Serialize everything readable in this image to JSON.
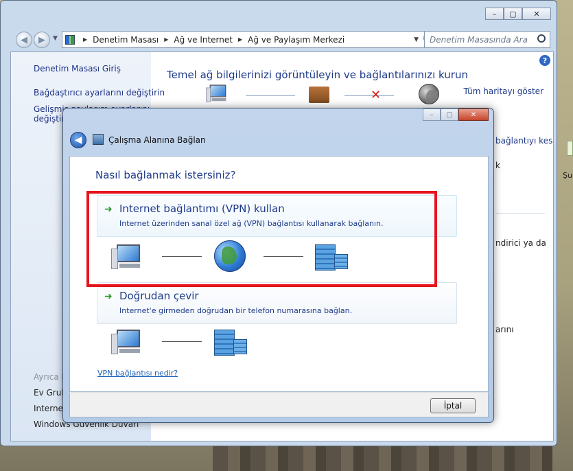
{
  "explorer": {
    "title_buttons": [
      "–",
      "▢",
      "✕"
    ],
    "breadcrumb": [
      "Denetim Masası",
      "Ağ ve Internet",
      "Ağ ve Paylaşım Merkezi"
    ],
    "search_placeholder": "Denetim Masasında Ara",
    "sidebar": {
      "items": [
        "Denetim Masası Giriş",
        "Bağdaştırıcı ayarlarını değiştirin",
        "Gelişmiş paylaşım ayarlarını",
        "değiştirin"
      ],
      "see_also": "Ayrıca bkz",
      "bottom_items": [
        "Ev Grubu",
        "Internet",
        "Windows Güvenlik Duvarı"
      ]
    },
    "main": {
      "title": "Temel ağ bilgilerinizi görüntüleyin ve bağlantılarınızı kurun",
      "map_link": "Tüm haritayı göster",
      "right_items": [
        "bağlantıyı kes",
        "k",
        "ndirici ya da",
        "arını"
      ]
    }
  },
  "desktop": {
    "icon_label": "Şub"
  },
  "dialog": {
    "title": "Çalışma Alanına Bağlan",
    "question": "Nasıl bağlanmak istersiniz?",
    "options": [
      {
        "title": "Internet bağlantımı (VPN) kullan",
        "description": "Internet üzerinden sanal özel ağ (VPN) bağlantısı kullanarak bağlanın."
      },
      {
        "title": "Doğrudan çevir",
        "description": "Internet'e girmeden doğrudan bir telefon numarasına bağlan."
      }
    ],
    "vpn_link": "VPN bağlantısı nedir?",
    "cancel_label": "İptal",
    "highlight_color": "#e5141e"
  }
}
